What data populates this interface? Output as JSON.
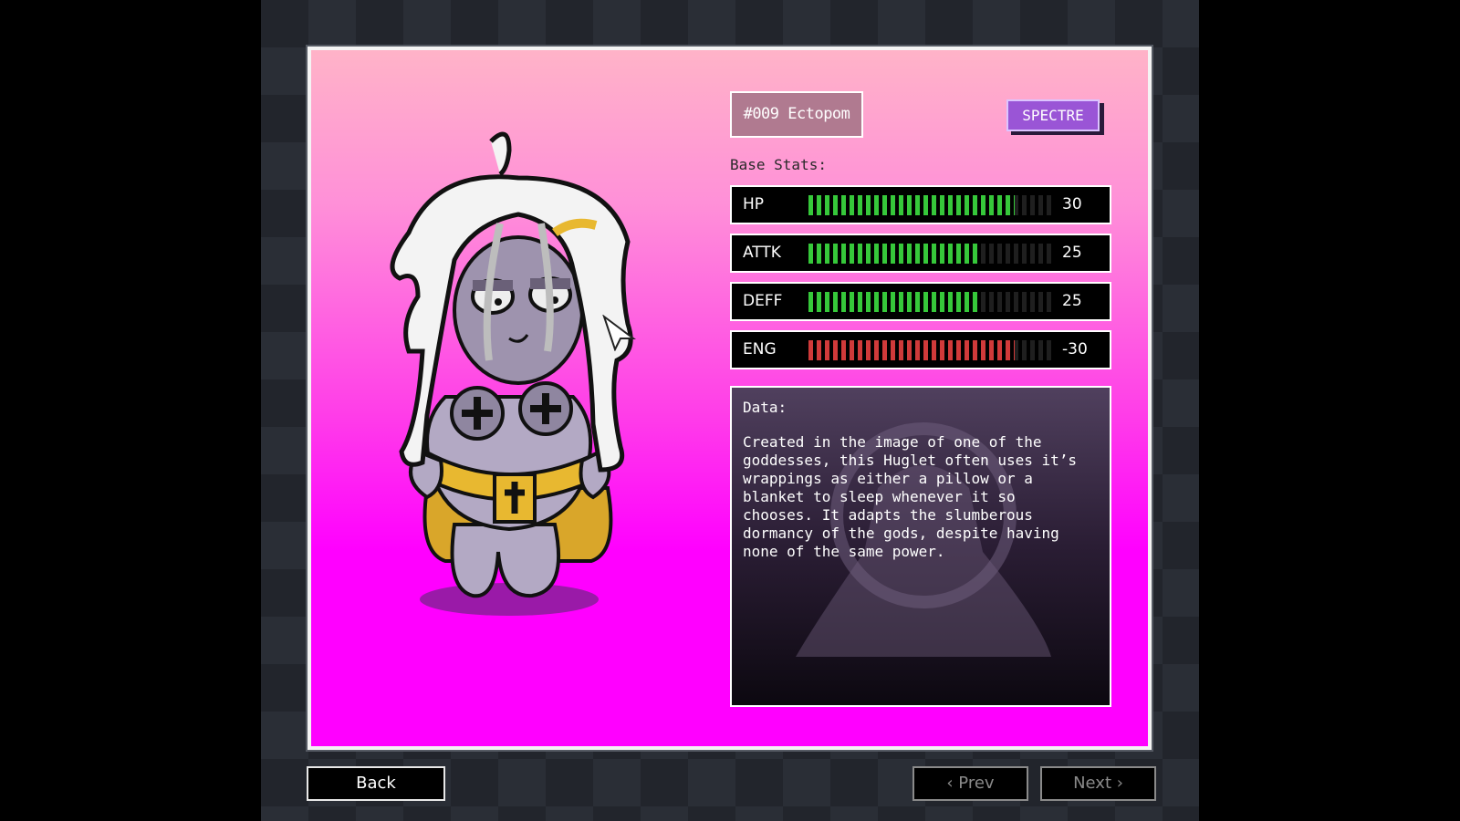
{
  "entry": {
    "id_label": "#009 Ectopom",
    "type_label": "SPECTRE",
    "base_stats_label": "Base Stats:"
  },
  "stats": [
    {
      "name": "HP",
      "value": "30",
      "fill": 0.85,
      "color": "green"
    },
    {
      "name": "ATTK",
      "value": "25",
      "fill": 0.71,
      "color": "green"
    },
    {
      "name": "DEFF",
      "value": "25",
      "fill": 0.71,
      "color": "green"
    },
    {
      "name": "ENG",
      "value": "-30",
      "fill": 0.85,
      "color": "red"
    }
  ],
  "data_panel": {
    "title": "Data:",
    "text": "Created in the image of one of the\ngoddesses, this Huglet often uses it’s\nwrappings as either a pillow or a\nblanket to sleep whenever it so\nchooses. It adapts the slumberous\ndormancy of the gods, despite having\nnone of the same power."
  },
  "nav": {
    "back_label": "Back",
    "prev_label": "‹ Prev",
    "next_label": "Next ›"
  },
  "colors": {
    "panel_top": "#ffb3c8",
    "panel_bottom": "#ff00ff",
    "stat_green": "#36c83a",
    "stat_red": "#d03a3a",
    "type_badge": "#9a55d6"
  }
}
